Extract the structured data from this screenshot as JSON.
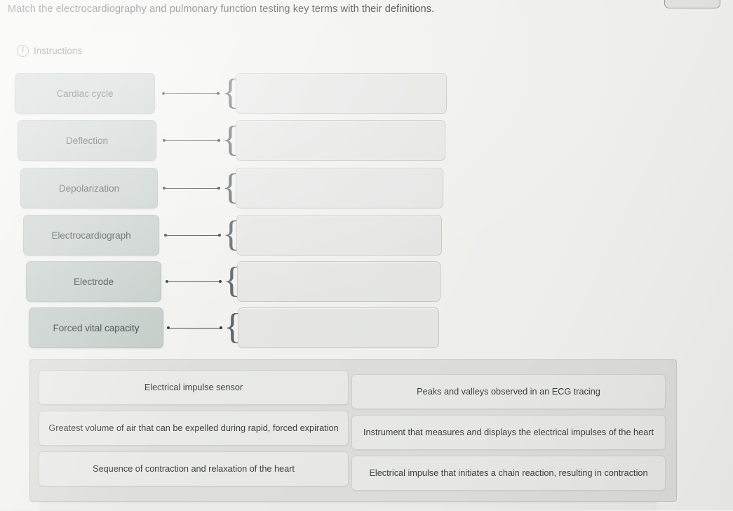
{
  "prompt": "Match the electrocardiography and pulmonary function testing key terms with their definitions.",
  "instructions": {
    "label": "Instructions",
    "icon": "info-circle-icon"
  },
  "colors": {
    "page_background": "#f1f1ee",
    "term_box": "#c2cbc7",
    "drop_zone": "#e6e7e5",
    "answer_bank_panel": "#dededa",
    "answer_bank_item": "#e9eae6",
    "text": "#3a3f42",
    "connector": "#3c4447"
  },
  "match_rows": [
    {
      "term": "Cardiac cycle",
      "answer": "",
      "connector": "line-with-dots",
      "brace": "{"
    },
    {
      "term": "Deflection",
      "answer": "",
      "connector": "line-with-dots",
      "brace": "{"
    },
    {
      "term": "Depolarization",
      "answer": "",
      "connector": "line-with-dots",
      "brace": "{"
    },
    {
      "term": "Electrocardiograph",
      "answer": "",
      "connector": "line-with-dots",
      "brace": "{"
    },
    {
      "term": "Electrode",
      "answer": "",
      "connector": "line-with-dots",
      "brace": "{"
    },
    {
      "term": "Forced vital capacity",
      "answer": "",
      "connector": "line-with-dots",
      "brace": "{"
    }
  ],
  "answer_bank": {
    "items": [
      "Electrical impulse sensor",
      "Peaks and valleys observed in an ECG tracing",
      "Greatest volume of air that can be expelled during rapid, forced expiration",
      "Instrument that measures and displays the electrical impulses of the heart",
      "Sequence of contraction and relaxation of the heart",
      "Electrical impulse that initiates a chain reaction, resulting in contraction"
    ]
  }
}
